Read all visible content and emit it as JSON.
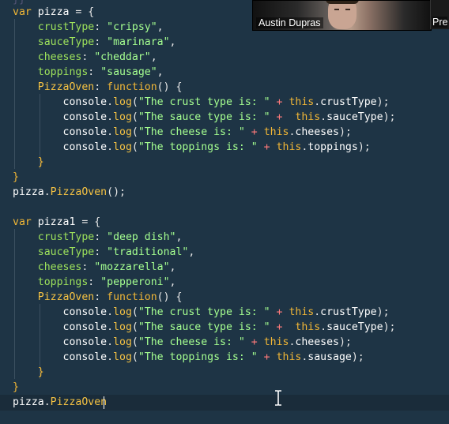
{
  "editor": {
    "partial_top_line": "}}",
    "lines": [
      {
        "tokens": [
          [
            "kw",
            "var"
          ],
          [
            "pun",
            " "
          ],
          [
            "id",
            "pizza"
          ],
          [
            "pun",
            " = {"
          ]
        ]
      },
      {
        "tokens": [
          [
            "pun",
            "    "
          ],
          [
            "prop",
            "crustType"
          ],
          [
            "pun",
            ": "
          ],
          [
            "str",
            "\"cripsy\""
          ],
          [
            "pun",
            ","
          ]
        ]
      },
      {
        "tokens": [
          [
            "pun",
            "    "
          ],
          [
            "prop",
            "sauceType"
          ],
          [
            "pun",
            ": "
          ],
          [
            "str",
            "\"marinara\""
          ],
          [
            "pun",
            ","
          ]
        ]
      },
      {
        "tokens": [
          [
            "pun",
            "    "
          ],
          [
            "prop",
            "cheeses"
          ],
          [
            "pun",
            ": "
          ],
          [
            "str",
            "\"cheddar\""
          ],
          [
            "pun",
            ","
          ]
        ]
      },
      {
        "tokens": [
          [
            "pun",
            "    "
          ],
          [
            "prop",
            "toppings"
          ],
          [
            "pun",
            ": "
          ],
          [
            "str",
            "\"sausage\""
          ],
          [
            "pun",
            ","
          ]
        ]
      },
      {
        "tokens": [
          [
            "pun",
            "    "
          ],
          [
            "fn",
            "PizzaOven"
          ],
          [
            "pun",
            ": "
          ],
          [
            "kw",
            "function"
          ],
          [
            "pun",
            "() {"
          ]
        ]
      },
      {
        "tokens": [
          [
            "pun",
            "        "
          ],
          [
            "id",
            "console"
          ],
          [
            "pun",
            "."
          ],
          [
            "fn",
            "log"
          ],
          [
            "pun",
            "("
          ],
          [
            "str",
            "\"The crust type is: \""
          ],
          [
            "pun",
            " "
          ],
          [
            "op",
            "+"
          ],
          [
            "pun",
            " "
          ],
          [
            "thisk",
            "this"
          ],
          [
            "pun",
            "."
          ],
          [
            "id",
            "crustType"
          ],
          [
            "pun",
            ");"
          ]
        ]
      },
      {
        "tokens": [
          [
            "pun",
            "        "
          ],
          [
            "id",
            "console"
          ],
          [
            "pun",
            "."
          ],
          [
            "fn",
            "log"
          ],
          [
            "pun",
            "("
          ],
          [
            "str",
            "\"The sauce type is: \""
          ],
          [
            "pun",
            " "
          ],
          [
            "op",
            "+"
          ],
          [
            "pun",
            "  "
          ],
          [
            "thisk",
            "this"
          ],
          [
            "pun",
            "."
          ],
          [
            "id",
            "sauceType"
          ],
          [
            "pun",
            ");"
          ]
        ]
      },
      {
        "tokens": [
          [
            "pun",
            "        "
          ],
          [
            "id",
            "console"
          ],
          [
            "pun",
            "."
          ],
          [
            "fn",
            "log"
          ],
          [
            "pun",
            "("
          ],
          [
            "str",
            "\"The cheese is: \""
          ],
          [
            "pun",
            " "
          ],
          [
            "op",
            "+"
          ],
          [
            "pun",
            " "
          ],
          [
            "thisk",
            "this"
          ],
          [
            "pun",
            "."
          ],
          [
            "id",
            "cheeses"
          ],
          [
            "pun",
            ");"
          ]
        ]
      },
      {
        "tokens": [
          [
            "pun",
            "        "
          ],
          [
            "id",
            "console"
          ],
          [
            "pun",
            "."
          ],
          [
            "fn",
            "log"
          ],
          [
            "pun",
            "("
          ],
          [
            "str",
            "\"The toppings is: \""
          ],
          [
            "pun",
            " "
          ],
          [
            "op",
            "+"
          ],
          [
            "pun",
            " "
          ],
          [
            "thisk",
            "this"
          ],
          [
            "pun",
            "."
          ],
          [
            "id",
            "toppings"
          ],
          [
            "pun",
            ");"
          ]
        ]
      },
      {
        "tokens": [
          [
            "pun",
            "    "
          ],
          [
            "kw",
            "}"
          ]
        ]
      },
      {
        "tokens": [
          [
            "kw",
            "}"
          ]
        ]
      },
      {
        "tokens": [
          [
            "id",
            "pizza"
          ],
          [
            "pun",
            "."
          ],
          [
            "fn",
            "PizzaOven"
          ],
          [
            "pun",
            "();"
          ]
        ]
      },
      {
        "tokens": [
          [
            "pun",
            ""
          ]
        ]
      },
      {
        "tokens": [
          [
            "kw",
            "var"
          ],
          [
            "pun",
            " "
          ],
          [
            "id",
            "pizza1"
          ],
          [
            "pun",
            " = {"
          ]
        ]
      },
      {
        "tokens": [
          [
            "pun",
            "    "
          ],
          [
            "prop",
            "crustType"
          ],
          [
            "pun",
            ": "
          ],
          [
            "str",
            "\"deep dish\""
          ],
          [
            "pun",
            ","
          ]
        ]
      },
      {
        "tokens": [
          [
            "pun",
            "    "
          ],
          [
            "prop",
            "sauceType"
          ],
          [
            "pun",
            ": "
          ],
          [
            "str",
            "\"traditional\""
          ],
          [
            "pun",
            ","
          ]
        ]
      },
      {
        "tokens": [
          [
            "pun",
            "    "
          ],
          [
            "prop",
            "cheeses"
          ],
          [
            "pun",
            ": "
          ],
          [
            "str",
            "\"mozzarella\""
          ],
          [
            "pun",
            ","
          ]
        ]
      },
      {
        "tokens": [
          [
            "pun",
            "    "
          ],
          [
            "prop",
            "toppings"
          ],
          [
            "pun",
            ": "
          ],
          [
            "str",
            "\"pepperoni\""
          ],
          [
            "pun",
            ","
          ]
        ]
      },
      {
        "tokens": [
          [
            "pun",
            "    "
          ],
          [
            "fn",
            "PizzaOven"
          ],
          [
            "pun",
            ": "
          ],
          [
            "kw",
            "function"
          ],
          [
            "pun",
            "() {"
          ]
        ]
      },
      {
        "tokens": [
          [
            "pun",
            "        "
          ],
          [
            "id",
            "console"
          ],
          [
            "pun",
            "."
          ],
          [
            "fn",
            "log"
          ],
          [
            "pun",
            "("
          ],
          [
            "str",
            "\"The crust type is: \""
          ],
          [
            "pun",
            " "
          ],
          [
            "op",
            "+"
          ],
          [
            "pun",
            " "
          ],
          [
            "thisk",
            "this"
          ],
          [
            "pun",
            "."
          ],
          [
            "id",
            "crustType"
          ],
          [
            "pun",
            ");"
          ]
        ]
      },
      {
        "tokens": [
          [
            "pun",
            "        "
          ],
          [
            "id",
            "console"
          ],
          [
            "pun",
            "."
          ],
          [
            "fn",
            "log"
          ],
          [
            "pun",
            "("
          ],
          [
            "str",
            "\"The sauce type is: \""
          ],
          [
            "pun",
            " "
          ],
          [
            "op",
            "+"
          ],
          [
            "pun",
            "  "
          ],
          [
            "thisk",
            "this"
          ],
          [
            "pun",
            "."
          ],
          [
            "id",
            "sauceType"
          ],
          [
            "pun",
            ");"
          ]
        ]
      },
      {
        "tokens": [
          [
            "pun",
            "        "
          ],
          [
            "id",
            "console"
          ],
          [
            "pun",
            "."
          ],
          [
            "fn",
            "log"
          ],
          [
            "pun",
            "("
          ],
          [
            "str",
            "\"The cheese is: \""
          ],
          [
            "pun",
            " "
          ],
          [
            "op",
            "+"
          ],
          [
            "pun",
            " "
          ],
          [
            "thisk",
            "this"
          ],
          [
            "pun",
            "."
          ],
          [
            "id",
            "cheeses"
          ],
          [
            "pun",
            ");"
          ]
        ]
      },
      {
        "tokens": [
          [
            "pun",
            "        "
          ],
          [
            "id",
            "console"
          ],
          [
            "pun",
            "."
          ],
          [
            "fn",
            "log"
          ],
          [
            "pun",
            "("
          ],
          [
            "str",
            "\"The toppings is: \""
          ],
          [
            "pun",
            " "
          ],
          [
            "op",
            "+"
          ],
          [
            "pun",
            " "
          ],
          [
            "thisk",
            "this"
          ],
          [
            "pun",
            "."
          ],
          [
            "id",
            "sausage"
          ],
          [
            "pun",
            ");"
          ]
        ]
      },
      {
        "tokens": [
          [
            "pun",
            "    "
          ],
          [
            "kw",
            "}"
          ]
        ]
      },
      {
        "tokens": [
          [
            "kw",
            "}"
          ]
        ]
      },
      {
        "tokens": [
          [
            "id",
            "pizza"
          ],
          [
            "pun",
            "."
          ],
          [
            "fn",
            "PizzaOven"
          ]
        ]
      }
    ]
  },
  "video": {
    "participant_1": "Austin Dupras",
    "participant_2": "Pre"
  }
}
